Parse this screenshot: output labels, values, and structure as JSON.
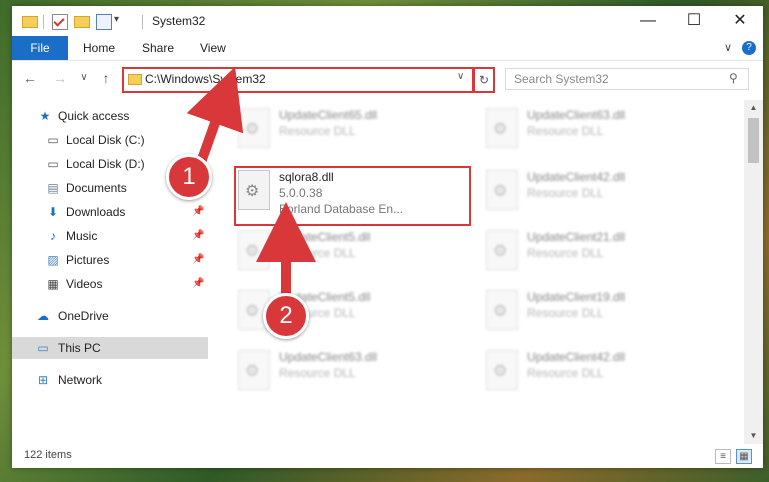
{
  "window": {
    "title": "System32",
    "qat_dropdown": "▾",
    "minimize": "—",
    "maximize": "☐",
    "close": "✕"
  },
  "ribbon": {
    "tabs": [
      "File",
      "Home",
      "Share",
      "View"
    ],
    "expand": "∨",
    "help": "?"
  },
  "nav": {
    "back": "←",
    "forward": "→",
    "recent": "∨",
    "up": "↑"
  },
  "address": {
    "path": "C:\\Windows\\System32",
    "dropdown": "∨",
    "refresh": "↻"
  },
  "search": {
    "placeholder": "Search System32",
    "icon": "search-icon",
    "glyph": "⚲"
  },
  "sidebar": {
    "items": [
      {
        "label": "Quick access",
        "icon": "star-icon",
        "glyph": "★",
        "color": "#1a6ec8"
      },
      {
        "label": "Local Disk (C:)",
        "icon": "drive-icon",
        "glyph": "▭",
        "color": "#555555"
      },
      {
        "label": "Local Disk (D:)",
        "icon": "drive-icon",
        "glyph": "▭",
        "color": "#555555"
      },
      {
        "label": "Documents",
        "icon": "document-icon",
        "glyph": "▤",
        "color": "#6a7f99",
        "pinned": true
      },
      {
        "label": "Downloads",
        "icon": "download-icon",
        "glyph": "⬇",
        "color": "#1a6ec8",
        "pinned": true
      },
      {
        "label": "Music",
        "icon": "music-icon",
        "glyph": "♪",
        "color": "#1a6ec8",
        "pinned": true
      },
      {
        "label": "Pictures",
        "icon": "pictures-icon",
        "glyph": "▨",
        "color": "#4a7fc0",
        "pinned": true
      },
      {
        "label": "Videos",
        "icon": "video-icon",
        "glyph": "▦",
        "color": "#444444",
        "pinned": true
      },
      {
        "label": "OneDrive",
        "icon": "cloud-icon",
        "glyph": "☁",
        "color": "#1a6ec8"
      },
      {
        "label": "This PC",
        "icon": "computer-icon",
        "glyph": "▭",
        "color": "#3a7fc8",
        "selected": true
      },
      {
        "label": "Network",
        "icon": "network-icon",
        "glyph": "⊞",
        "color": "#3a7fc8"
      }
    ],
    "pin_glyph": "📌"
  },
  "files": [
    {
      "name": "UpdateClient65.dll",
      "desc": "Resource DLL",
      "blurred": true
    },
    {
      "name": "UpdateClient63.dll",
      "desc": "Resource DLL",
      "blurred": true
    },
    {
      "name": "sqlora8.dll",
      "version": "5.0.0.38",
      "desc": "Borland Database En...",
      "blurred": false
    },
    {
      "name": "UpdateClient42.dll",
      "desc": "Resource DLL",
      "blurred": true
    },
    {
      "name": "UpdateClient5.dll",
      "desc": "Resource DLL",
      "blurred": true
    },
    {
      "name": "UpdateClient21.dll",
      "desc": "Resource DLL",
      "blurred": true
    },
    {
      "name": "UpdateClient5.dll",
      "desc": "Resource DLL",
      "blurred": true
    },
    {
      "name": "UpdateClient19.dll",
      "desc": "Resource DLL",
      "blurred": true
    },
    {
      "name": "UpdateClient63.dll",
      "desc": "Resource DLL",
      "blurred": true
    },
    {
      "name": "UpdateClient42.dll",
      "desc": "Resource DLL",
      "blurred": true
    }
  ],
  "status": {
    "item_count": "122 items"
  },
  "annotations": {
    "step1": "1",
    "step2": "2",
    "color": "#d9383a"
  }
}
